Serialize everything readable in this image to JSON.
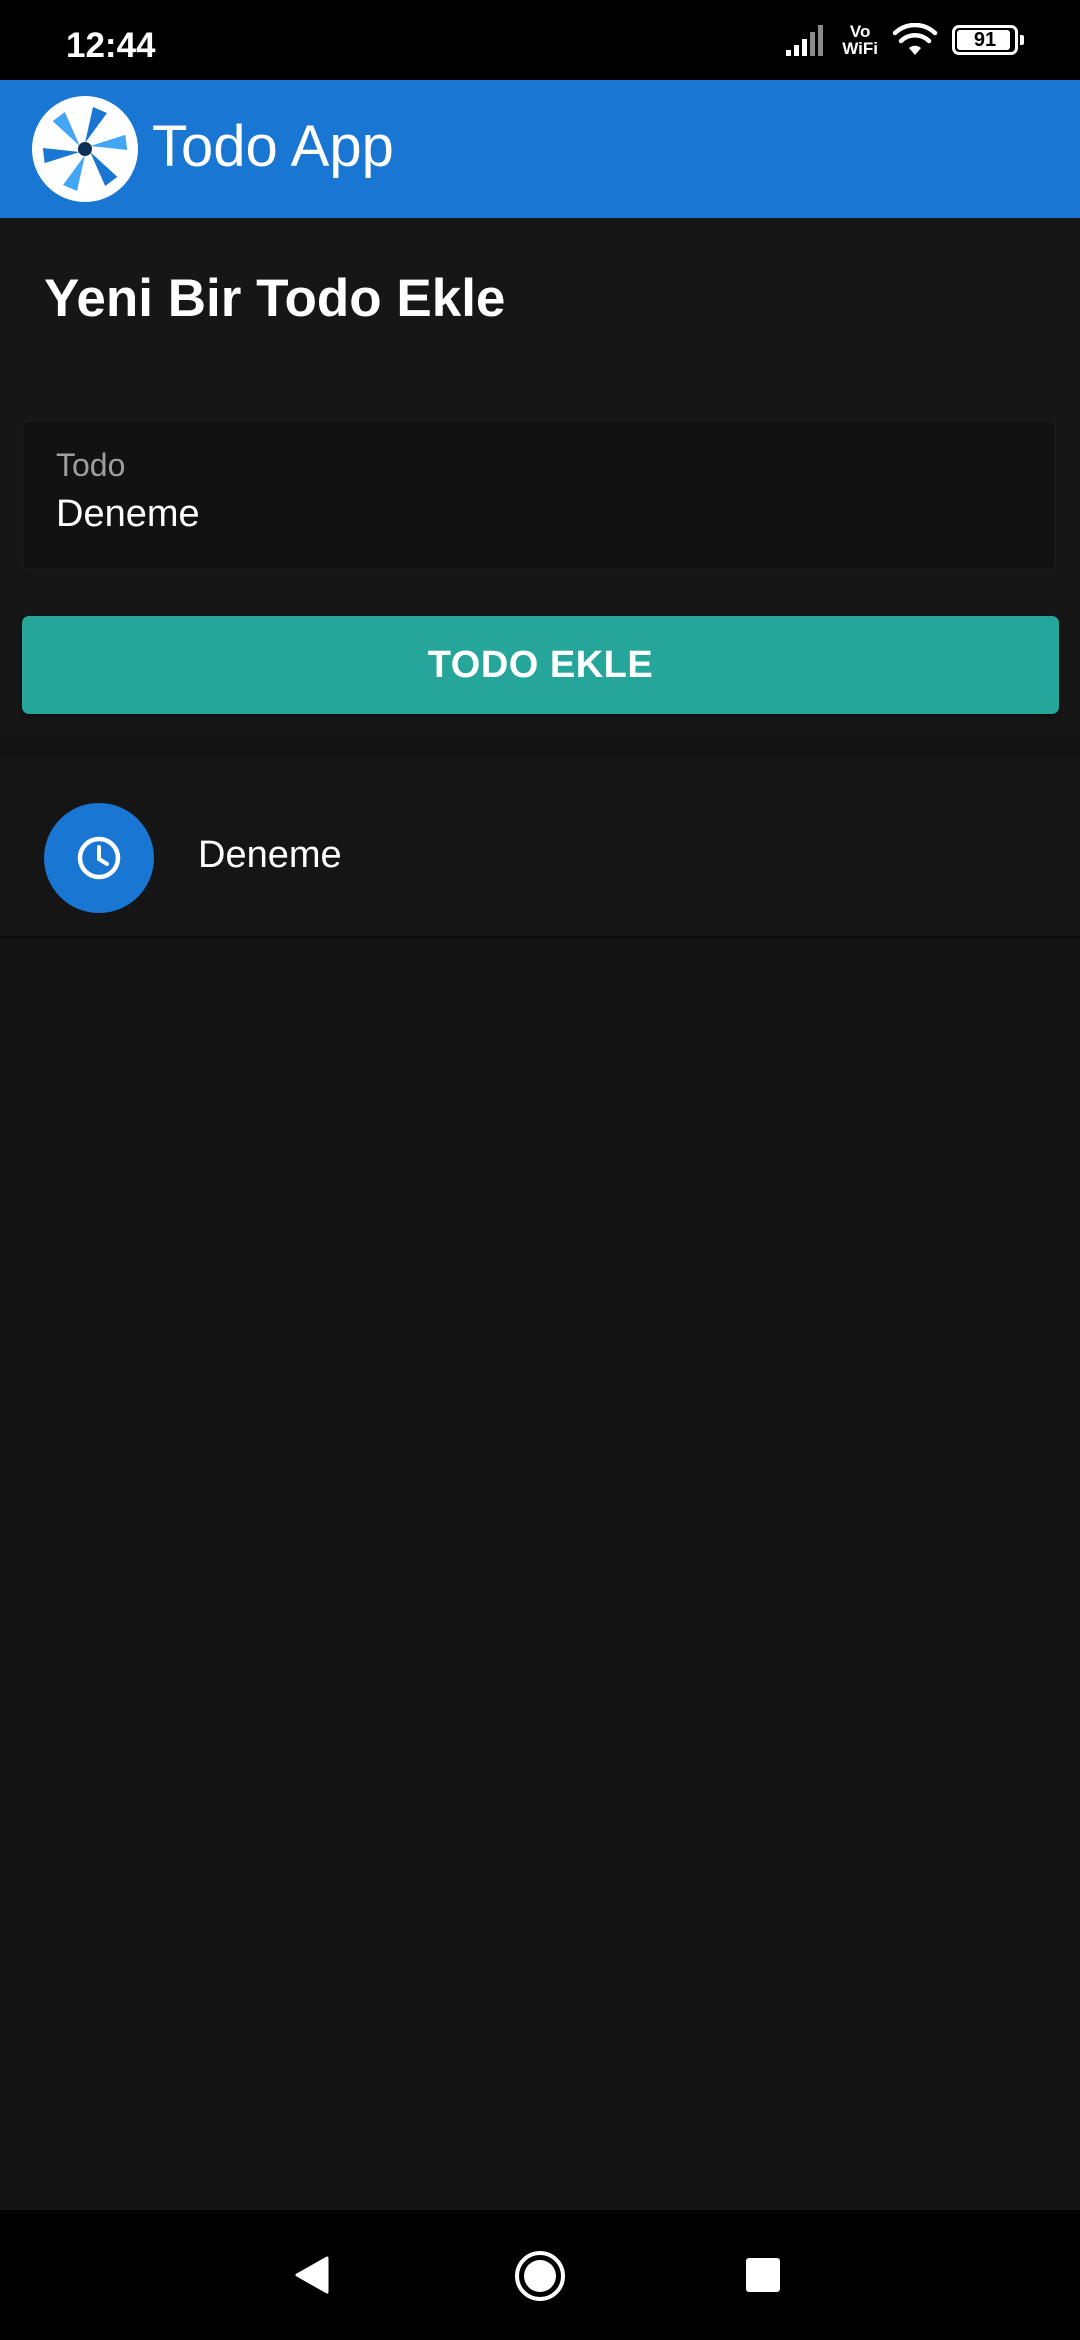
{
  "status_bar": {
    "time": "12:44",
    "vowifi_top": "Vo",
    "vowifi_bottom": "WiFi",
    "battery": "91",
    "icons": [
      "signal-icon",
      "vowifi-icon",
      "wifi-icon",
      "battery-icon"
    ]
  },
  "app_bar": {
    "title": "Todo App",
    "logo_icon": "app-logo-icon",
    "color": "#1976d2"
  },
  "form": {
    "heading": "Yeni Bir Todo Ekle",
    "input_label": "Todo",
    "input_value": "Deneme",
    "button_label": "TODO EKLE",
    "button_color": "#26a69a"
  },
  "todos": [
    {
      "text": "Deneme",
      "icon": "clock-icon"
    }
  ],
  "nav_bar": {
    "icons": [
      "back-icon",
      "home-icon",
      "recents-icon"
    ]
  }
}
